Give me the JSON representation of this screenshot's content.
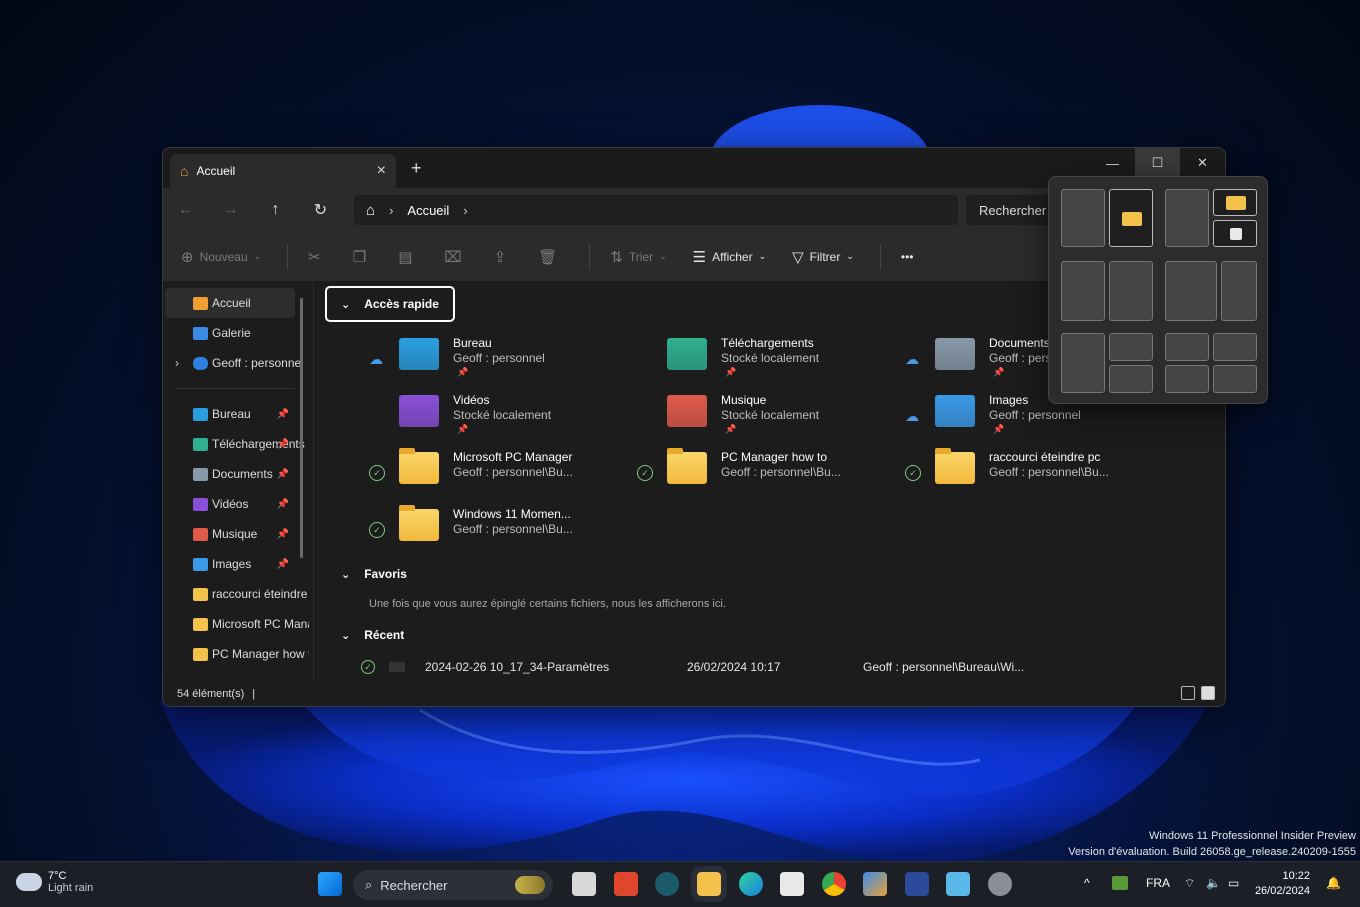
{
  "window": {
    "tab_title": "Accueil",
    "breadcrumb": [
      "Accueil"
    ],
    "search_placeholder": "Rechercher dans Accueil",
    "search_visible": "Rechercher "
  },
  "toolbar": {
    "new_label": "Nouveau",
    "sort_label": "Trier",
    "view_label": "Afficher",
    "filter_label": "Filtrer",
    "more_label": "•••"
  },
  "sidebar": {
    "top": [
      {
        "label": "Accueil",
        "color": "#f0a030"
      },
      {
        "label": "Galerie",
        "color": "#3a8be8"
      },
      {
        "label": "Geoff : personnel",
        "color": "#2f7fe0"
      }
    ],
    "pinned": [
      {
        "label": "Bureau",
        "color": "#2a9fe0",
        "pinned": true
      },
      {
        "label": "Téléchargements",
        "color": "#2fb090",
        "pinned": true
      },
      {
        "label": "Documents",
        "color": "#8899aa",
        "pinned": true
      },
      {
        "label": "Vidéos",
        "color": "#8a4fd8",
        "pinned": true
      },
      {
        "label": "Musique",
        "color": "#e05a4a",
        "pinned": true
      },
      {
        "label": "Images",
        "color": "#3a9ae8",
        "pinned": true
      },
      {
        "label": "raccourci éteindre pc",
        "color": "#f2c24a",
        "pinned": false
      },
      {
        "label": "Microsoft PC Manager",
        "color": "#f2c24a",
        "pinned": false
      },
      {
        "label": "PC Manager how to",
        "color": "#f2c24a",
        "pinned": false
      }
    ]
  },
  "sections": {
    "quick_access": "Accès rapide",
    "favorites": "Favoris",
    "favorites_hint": "Une fois que vous aurez épinglé certains fichiers, nous les afficherons ici.",
    "recent": "Récent"
  },
  "quick_items": [
    {
      "name": "Bureau",
      "sub": "Geoff : personnel",
      "status": "cloud",
      "pinned": true,
      "color": "#2a9fe0"
    },
    {
      "name": "Téléchargements",
      "sub": "Stocké localement",
      "status": "",
      "pinned": true,
      "color": "#2fb090"
    },
    {
      "name": "Documents",
      "sub": "Geoff : personnel",
      "status": "cloud",
      "pinned": true,
      "color": "#8899aa"
    },
    {
      "name": "Vidéos",
      "sub": "Stocké localement",
      "status": "",
      "pinned": true,
      "color": "#8a4fd8"
    },
    {
      "name": "Musique",
      "sub": "Stocké localement",
      "status": "",
      "pinned": true,
      "color": "#e05a4a"
    },
    {
      "name": "Images",
      "sub": "Geoff : personnel",
      "status": "cloud",
      "pinned": true,
      "color": "#3a9ae8"
    },
    {
      "name": "Microsoft PC Manager",
      "sub": "Geoff : personnel\\Bu...",
      "status": "check",
      "pinned": false,
      "color": "folder"
    },
    {
      "name": "PC Manager how to",
      "sub": "Geoff : personnel\\Bu...",
      "status": "check",
      "pinned": false,
      "color": "folder"
    },
    {
      "name": "raccourci éteindre pc",
      "sub": "Geoff : personnel\\Bu...",
      "status": "check",
      "pinned": false,
      "color": "folder"
    },
    {
      "name": "Windows 11 Momen...",
      "sub": "Geoff : personnel\\Bu...",
      "status": "check",
      "pinned": false,
      "color": "folder"
    }
  ],
  "recent_items": [
    {
      "name": "2024-02-26 10_17_34-Paramètres",
      "date": "26/02/2024 10:17",
      "location": "Geoff : personnel\\Bureau\\Wi..."
    }
  ],
  "status": {
    "count": "54 élément(s)",
    "cursor": "|"
  },
  "taskbar": {
    "temp": "7°C",
    "weather": "Light rain",
    "search": "Rechercher",
    "lang": "FRA",
    "time": "10:22",
    "date": "26/02/2024"
  },
  "watermark": {
    "line1": "Windows 11 Professionnel Insider Preview",
    "line2": "Version d'évaluation. Build 26058.ge_release.240209-1555"
  }
}
